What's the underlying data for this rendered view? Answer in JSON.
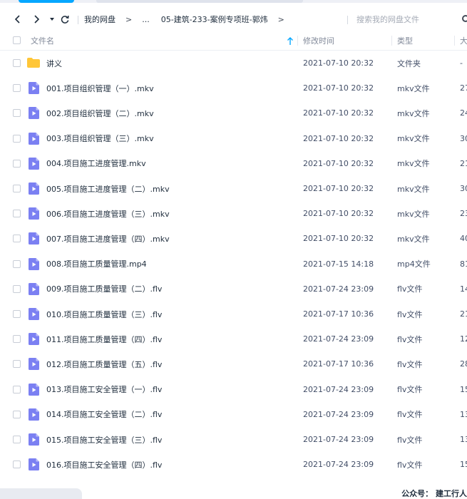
{
  "toolbar": {
    "breadcrumb": [
      "我的网盘",
      "...",
      "05-建筑-233-案例专项班-郭炜"
    ],
    "breadcrumb_separator": ">",
    "search_placeholder": "搜索我的网盘文件"
  },
  "header": {
    "name": "文件名",
    "modified": "修改时间",
    "type": "类型",
    "size": "大"
  },
  "icons": {
    "back": "chevron-left-icon",
    "forward": "chevron-right-icon",
    "history": "caret-down-icon",
    "refresh": "refresh-icon",
    "sort": "arrow-up-icon",
    "folder": "folder-icon",
    "video": "video-file-icon",
    "search": "search-icon"
  },
  "colors": {
    "accent": "#06a7ff",
    "folder": "#ffc638",
    "video_icon": "#7b80f2"
  },
  "files": [
    {
      "name": "讲义",
      "modified": "2021-07-10 20:32",
      "type": "文件夹",
      "size": "-",
      "kind": "folder"
    },
    {
      "name": "001.项目组织管理（一）.mkv",
      "modified": "2021-07-10 20:32",
      "type": "mkv文件",
      "size": "27",
      "kind": "video"
    },
    {
      "name": "002.项目组织管理（二）.mkv",
      "modified": "2021-07-10 20:32",
      "type": "mkv文件",
      "size": "24",
      "kind": "video"
    },
    {
      "name": "003.项目组织管理（三）.mkv",
      "modified": "2021-07-10 20:32",
      "type": "mkv文件",
      "size": "30",
      "kind": "video"
    },
    {
      "name": "004.项目施工进度管理.mkv",
      "modified": "2021-07-10 20:32",
      "type": "mkv文件",
      "size": "21",
      "kind": "video"
    },
    {
      "name": "005.项目施工进度管理（二）.mkv",
      "modified": "2021-07-10 20:32",
      "type": "mkv文件",
      "size": "30",
      "kind": "video"
    },
    {
      "name": "006.项目施工进度管理（三）.mkv",
      "modified": "2021-07-10 20:32",
      "type": "mkv文件",
      "size": "23",
      "kind": "video"
    },
    {
      "name": "007.项目施工进度管理（四）.mkv",
      "modified": "2021-07-10 20:32",
      "type": "mkv文件",
      "size": "40",
      "kind": "video"
    },
    {
      "name": "008.项目施工质量管理.mp4",
      "modified": "2021-07-15 14:18",
      "type": "mp4文件",
      "size": "81",
      "kind": "video"
    },
    {
      "name": "009.项目施工质量管理（二）.flv",
      "modified": "2021-07-24 23:09",
      "type": "flv文件",
      "size": "14",
      "kind": "video"
    },
    {
      "name": "010.项目施工质量管理（三）.flv",
      "modified": "2021-07-17 10:36",
      "type": "flv文件",
      "size": "21",
      "kind": "video"
    },
    {
      "name": "011.项目施工质量管理（四）.flv",
      "modified": "2021-07-24 23:09",
      "type": "flv文件",
      "size": "12",
      "kind": "video"
    },
    {
      "name": "012.项目施工质量管理（五）.flv",
      "modified": "2021-07-17 10:36",
      "type": "flv文件",
      "size": "28",
      "kind": "video"
    },
    {
      "name": "013.项目施工安全管理（一）.flv",
      "modified": "2021-07-24 23:09",
      "type": "flv文件",
      "size": "15",
      "kind": "video"
    },
    {
      "name": "014.项目施工安全管理（二）.flv",
      "modified": "2021-07-24 23:09",
      "type": "flv文件",
      "size": "13",
      "kind": "video"
    },
    {
      "name": "015.项目施工安全管理（三）.flv",
      "modified": "2021-07-24 23:09",
      "type": "flv文件",
      "size": "13",
      "kind": "video"
    },
    {
      "name": "016.项目施工安全管理（四）.flv",
      "modified": "2021-07-24 23:09",
      "type": "flv文件",
      "size": "15",
      "kind": "video"
    }
  ],
  "watermark": "公众号：  建工行人"
}
